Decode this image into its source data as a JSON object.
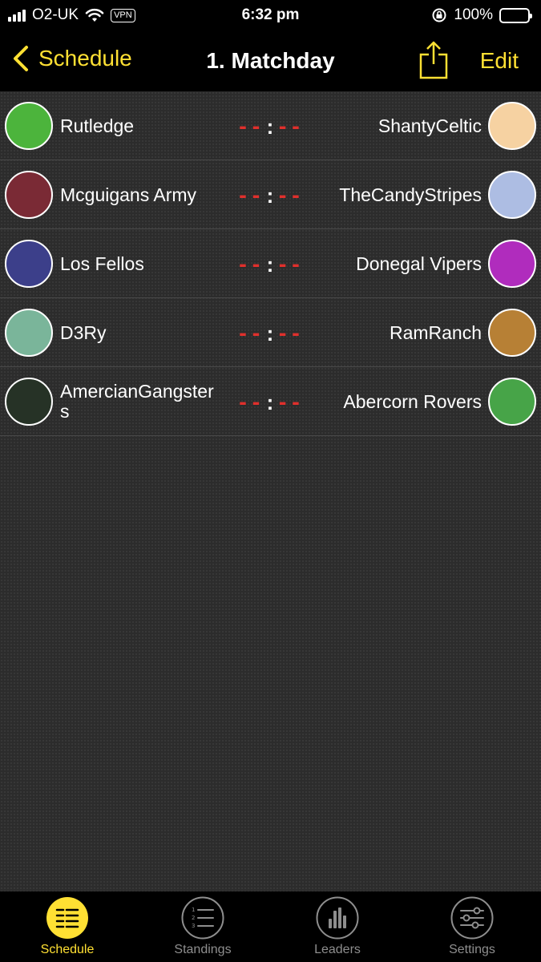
{
  "status": {
    "carrier": "O2-UK",
    "vpn": "VPN",
    "time": "6:32 pm",
    "battery": "100%"
  },
  "nav": {
    "back_label": "Schedule",
    "title": "1. Matchday",
    "edit_label": "Edit",
    "accent_color": "#ffe033"
  },
  "matches": [
    {
      "home": "Rutledge",
      "home_color": "#4cb43c",
      "away": "ShantyCeltic",
      "away_color": "#f6d2a2",
      "home_score": "--",
      "away_score": "--"
    },
    {
      "home": "Mcguigans Army",
      "home_color": "#7a2a35",
      "away": "TheCandyStripes",
      "away_color": "#adbde3",
      "home_score": "--",
      "away_score": "--"
    },
    {
      "home": "Los Fellos",
      "home_color": "#3c3f8a",
      "away": "Donegal Vipers",
      "away_color": "#b02cbd",
      "home_score": "--",
      "away_score": "--"
    },
    {
      "home": "D3Ry",
      "home_color": "#7ab59a",
      "away": "RamRanch",
      "away_color": "#b78035",
      "home_score": "--",
      "away_score": "--"
    },
    {
      "home": "AmercianGangsters",
      "home_color": "#263226",
      "away": "Abercorn Rovers",
      "away_color": "#47a448",
      "home_score": "--",
      "away_score": "--"
    }
  ],
  "tabs": [
    {
      "label": "Schedule",
      "icon": "schedule-icon",
      "active": true
    },
    {
      "label": "Standings",
      "icon": "standings-icon",
      "active": false
    },
    {
      "label": "Leaders",
      "icon": "leaders-icon",
      "active": false
    },
    {
      "label": "Settings",
      "icon": "settings-icon",
      "active": false
    }
  ]
}
